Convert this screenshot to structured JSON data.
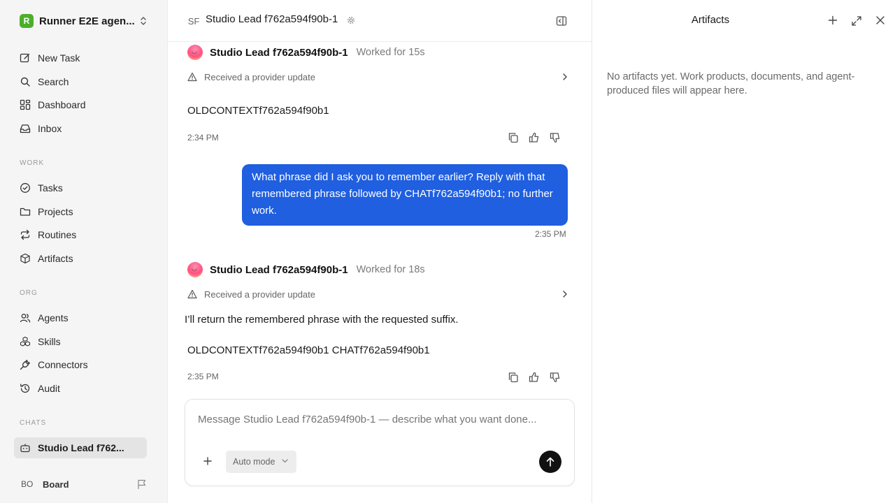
{
  "workspace": {
    "logo_letter": "R",
    "name": "Runner E2E agen..."
  },
  "nav": {
    "new_task": "New Task",
    "search": "Search",
    "dashboard": "Dashboard",
    "inbox": "Inbox"
  },
  "sections": {
    "work": "WORK",
    "org": "ORG",
    "chats": "CHATS"
  },
  "work_items": [
    "Tasks",
    "Projects",
    "Routines",
    "Artifacts"
  ],
  "org_items": [
    "Agents",
    "Skills",
    "Connectors",
    "Audit"
  ],
  "chats": [
    {
      "label": "Studio Lead f762...",
      "active": true
    }
  ],
  "board": {
    "initials": "BO",
    "label": "Board"
  },
  "chat": {
    "header_initials": "SF",
    "title": "Studio Lead f762a594f90b-1",
    "messages": [
      {
        "agent": "Studio Lead f762a594f90b-1",
        "worked": "Worked for 15s",
        "provider_update": "Received a provider update",
        "text": "OLDCONTEXTf762a594f90b1",
        "time": "2:34 PM"
      },
      {
        "user_text": "What phrase did I ask you to remember earlier? Reply with that remembered phrase followed by CHATf762a594f90b1; no further work.",
        "time": "2:35 PM"
      },
      {
        "agent": "Studio Lead f762a594f90b-1",
        "worked": "Worked for 18s",
        "provider_update": "Received a provider update",
        "intro": "I’ll return the remembered phrase with the requested suffix.",
        "text": "OLDCONTEXTf762a594f90b1 CHATf762a594f90b1",
        "time": "2:35 PM"
      }
    ],
    "composer": {
      "placeholder": "Message Studio Lead f762a594f90b-1 — describe what you want done...",
      "mode": "Auto mode"
    }
  },
  "artifacts": {
    "title": "Artifacts",
    "empty_text": "No artifacts yet. Work products, documents, and agent-produced files will appear here."
  },
  "colors": {
    "accent": "#1f5fe0",
    "sidebar_bg": "#f5f5f5",
    "logo_green": "#4caf2a"
  }
}
